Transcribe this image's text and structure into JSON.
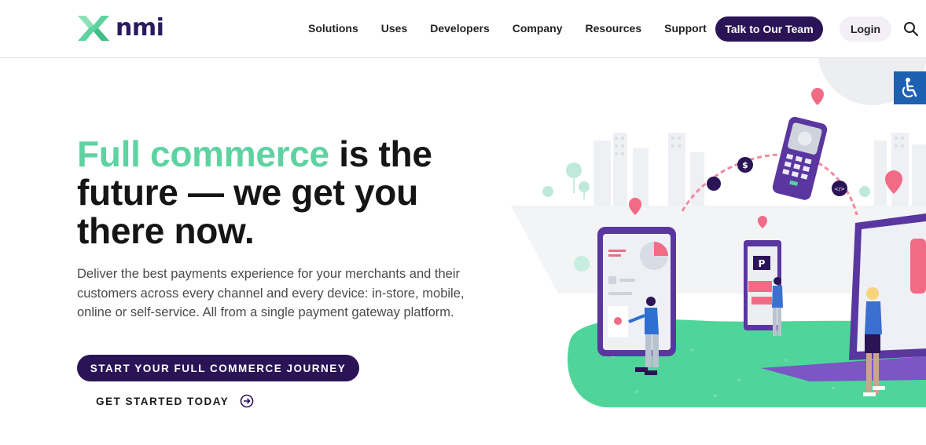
{
  "brand": {
    "name": "nmi",
    "accent": "#5ed3a1",
    "primary": "#2a1456"
  },
  "nav": {
    "items": [
      "Solutions",
      "Uses",
      "Developers",
      "Company",
      "Resources",
      "Support"
    ],
    "talk_label": "Talk to Our Team",
    "login_label": "Login",
    "search_icon": "search-icon"
  },
  "hero": {
    "headline_accent": "Full commerce",
    "headline_rest_1": " is the",
    "headline_line2": "future — we get you",
    "headline_line3": "there now.",
    "subtext": "Deliver the best payments experience for your merchants and their customers across every channel and every device: in-store, mobile, online or self-service. All from a single payment gateway platform.",
    "cta_primary": "START YOUR FULL COMMERCE JOURNEY",
    "cta_secondary": "GET STARTED TODAY"
  },
  "illustration": {
    "kiosk_sign": "P",
    "coin_symbol": "$",
    "code_symbol": "</>"
  },
  "accessibility": {
    "icon": "wheelchair-icon"
  }
}
